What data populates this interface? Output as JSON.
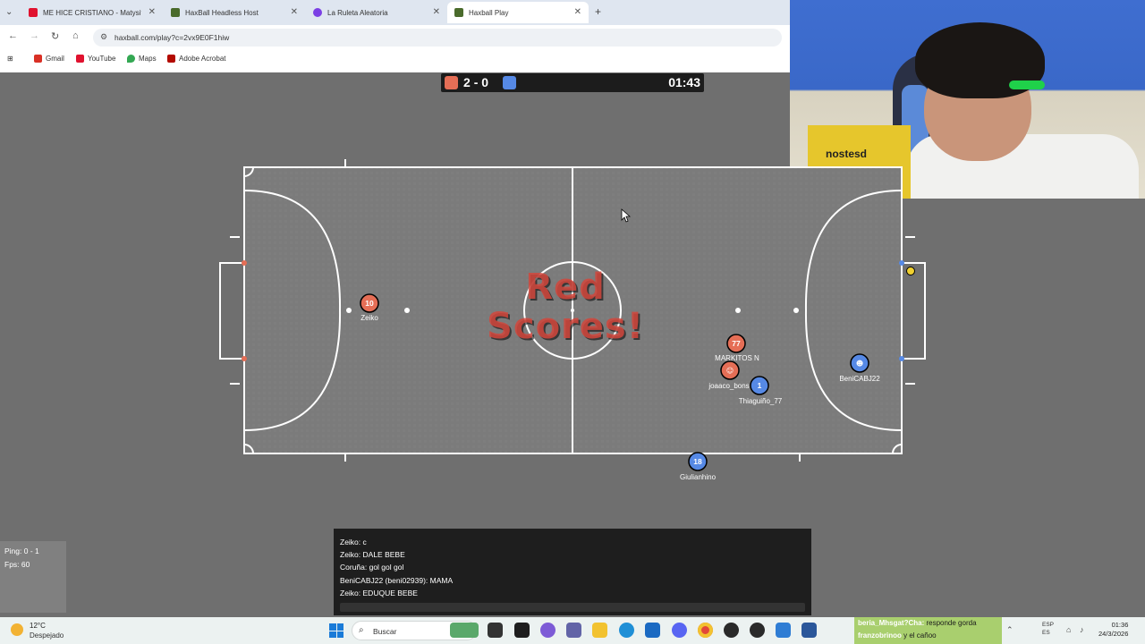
{
  "browser": {
    "tabs": [
      {
        "title": "ME HICE CRISTIANO - Matysito",
        "color": "#e0122f",
        "active": false
      },
      {
        "title": "HaxBall Headless Host",
        "color": "#4a6b2c",
        "active": false
      },
      {
        "title": "La Ruleta Aleatoria",
        "color": "#7b3fe4",
        "active": false
      },
      {
        "title": "Haxball Play",
        "color": "#4a6b2c",
        "active": true
      }
    ],
    "url": "haxball.com/play?c=2vx9E0F1hiw",
    "bookmarks": [
      "Gmail",
      "YouTube",
      "Maps",
      "Adobe Acrobat"
    ]
  },
  "webcam": {
    "box_text": "nostesd"
  },
  "game": {
    "score_red": "2",
    "score_dash": "-",
    "score_blue": "0",
    "time": "01:43",
    "red_color": "#e56e56",
    "blue_color": "#5689e5",
    "banner_line1": "Red",
    "banner_line2": "Scores!",
    "players": [
      {
        "number": "10",
        "name": "Zeiko",
        "team": "red"
      },
      {
        "number": "77",
        "name": "MARKITOS N",
        "team": "red"
      },
      {
        "number": "",
        "name": "joaaco_bons",
        "team": "red"
      },
      {
        "number": "1",
        "name": "Thiaguiño_77",
        "team": "blue"
      },
      {
        "number": "",
        "name": "BeniCABJ22",
        "team": "blue"
      },
      {
        "number": "18",
        "name": "Giulianhino",
        "team": "blue"
      }
    ]
  },
  "stats": {
    "ping": "Ping: 0 - 1",
    "fps": "Fps: 60"
  },
  "chat": {
    "messages": [
      "Zeiko: c",
      "Zeiko: DALE BEBE",
      "Coruña: gol gol gol",
      "BeniCABJ22 (beni02939): MAMA",
      "Zeiko: EDUQUE BEBE"
    ]
  },
  "taskbar": {
    "temperature": "12°C",
    "weather": "Despejado",
    "search_placeholder": "Buscar",
    "notif_line1_user": "beria_Mhsgat?Cha:",
    "notif_line1_text": "responde gorda",
    "notif_line2_user": "franzobrinoo",
    "notif_line2_text": "y el cañoo",
    "lang1": "ESP",
    "lang2": "ES",
    "time": "01:36",
    "date": "24/3/2026"
  }
}
